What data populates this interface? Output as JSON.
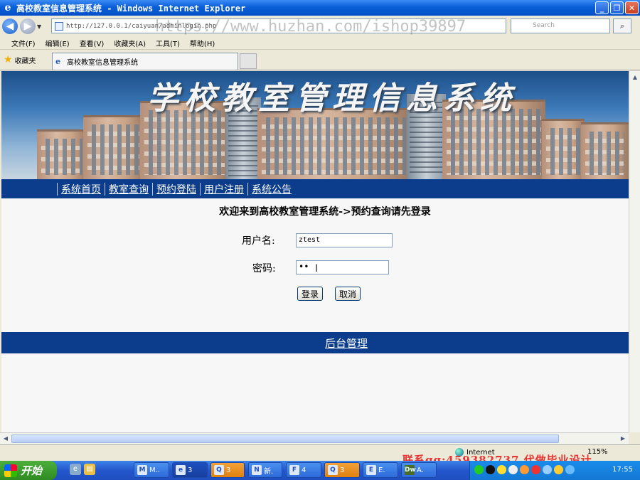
{
  "window": {
    "title": "高校教室信息管理系统 - Windows Internet Explorer",
    "minimize": "_",
    "maximize": "❐",
    "close": "✕"
  },
  "address": {
    "url": "http://127.0.0.1/caiyuan/adminlogin.php",
    "search_placeholder": "Search",
    "watermark": "https://www.huzhan.com/ishop39897"
  },
  "menubar": {
    "items": [
      "文件(F)",
      "编辑(E)",
      "查看(V)",
      "收藏夹(A)",
      "工具(T)",
      "帮助(H)"
    ]
  },
  "tabs": {
    "favorites_label": "收藏夹",
    "active_tab": "高校教室信息管理系统"
  },
  "page": {
    "banner_title": "学校教室管理信息系统",
    "nav": [
      "系统首页",
      "教室查询",
      "预约登陆",
      "用户注册",
      "系统公告"
    ],
    "welcome": "欢迎来到高校教室管理系统->预约查询请先登录",
    "login": {
      "username_label": "用户名:",
      "username_value": "ztest",
      "password_label": "密码:",
      "password_value": "••",
      "login_button": "登录",
      "cancel_button": "取消"
    },
    "admin_link": "后台管理"
  },
  "statusbar": {
    "zone": "Internet",
    "zoom": "115%",
    "watermark": "联系qq:459382737 代做毕业设计"
  },
  "taskbar": {
    "start": "开始",
    "clock": "17:55",
    "tasks": [
      {
        "icon": "M",
        "label": "M.."
      },
      {
        "icon": "e",
        "label": "3"
      },
      {
        "icon": "Q",
        "label": "3"
      },
      {
        "icon": "N",
        "label": "新."
      },
      {
        "icon": "F",
        "label": "4"
      },
      {
        "icon": "Q",
        "label": "3"
      },
      {
        "icon": "E",
        "label": "E."
      },
      {
        "icon": "Dw",
        "label": "A."
      }
    ]
  },
  "colors": {
    "nav_bg": "#0b3d8c",
    "titlebar": "#0a5fd8",
    "watermark_red": "#e61414"
  }
}
